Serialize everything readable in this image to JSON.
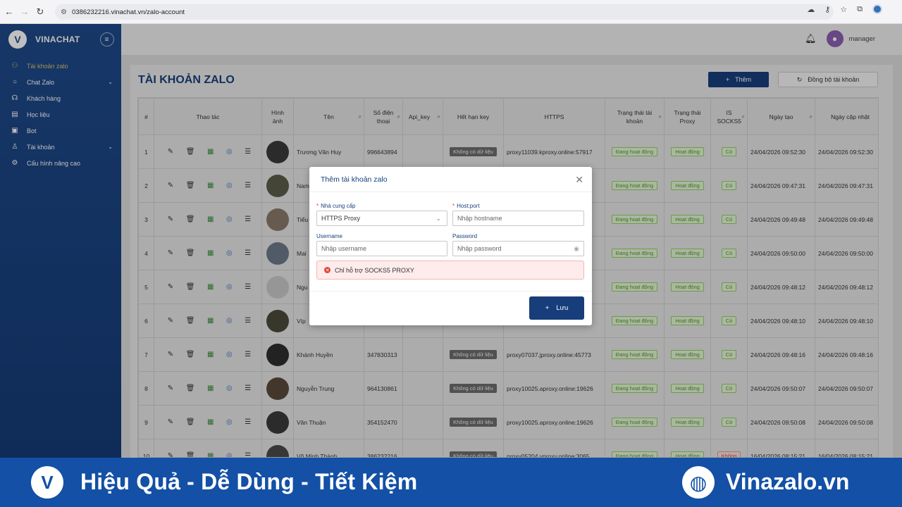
{
  "browser": {
    "url": "0386232216.vinachat.vn/zalo-account"
  },
  "sidebar": {
    "brand": "VINACHAT",
    "items": [
      {
        "label": "Tài khoản zalo",
        "icon": "users-icon",
        "active": true
      },
      {
        "label": "Chat Zalo",
        "icon": "chat-icon",
        "has_chevron": true
      },
      {
        "label": "Khách hàng",
        "icon": "headset-icon"
      },
      {
        "label": "Học liệu",
        "icon": "document-icon"
      },
      {
        "label": "Bot",
        "icon": "bot-icon"
      },
      {
        "label": "Tài khoản",
        "icon": "user-icon",
        "has_chevron": true
      },
      {
        "label": "Cấu hình nâng cao",
        "icon": "gear-icon"
      }
    ]
  },
  "header": {
    "user_name": "manager"
  },
  "page": {
    "title": "TÀI KHOẢN ZALO",
    "add_button": "Thêm",
    "sync_button": "Đồng bộ tài khoản"
  },
  "table": {
    "headers": {
      "num": "#",
      "actions": "Thao tác",
      "image": "Hình ảnh",
      "name": "Tên",
      "phone": "Số điện thoại",
      "api_key": "Api_key",
      "expire": "Hết hạn key",
      "https": "HTTPS",
      "account_status": "Trạng thái tài khoản",
      "proxy_status": "Trạng thái Proxy",
      "socks5": "IS SOCKS5",
      "created": "Ngày tạo",
      "updated": "Ngày cập nhật"
    },
    "rows": [
      {
        "num": "1",
        "name": "Trương Văn Huy",
        "phone": "996643894",
        "expire": "Không có dữ liệu",
        "https": "proxy11039.kproxy.online:57917",
        "account_status": "Đang hoạt động",
        "proxy_status": "Hoạt động",
        "socks5": "Có",
        "created": "24/04/2026 09:52:30",
        "updated": "24/04/2026 09:52:30",
        "avatar_color": "#3a3a3a"
      },
      {
        "num": "2",
        "name": "Nam",
        "phone": "",
        "expire": "",
        "https": "17",
        "account_status": "Đang hoạt động",
        "proxy_status": "Hoạt động",
        "socks5": "Có",
        "created": "24/04/2026 09:47:31",
        "updated": "24/04/2026 09:47:31",
        "avatar_color": "#5b5b4a"
      },
      {
        "num": "3",
        "name": "Tiểu",
        "phone": "",
        "expire": "",
        "https": "26",
        "account_status": "Đang hoạt động",
        "proxy_status": "Hoạt động",
        "socks5": "Có",
        "created": "24/04/2026 09:49:48",
        "updated": "24/04/2026 09:49:48",
        "avatar_color": "#8a7a6a"
      },
      {
        "num": "4",
        "name": "Mai",
        "phone": "",
        "expire": "",
        "https": "26",
        "account_status": "Đang hoạt động",
        "proxy_status": "Hoạt động",
        "socks5": "Có",
        "created": "24/04/2026 09:50:00",
        "updated": "24/04/2026 09:50:00",
        "avatar_color": "#6b7a8a"
      },
      {
        "num": "5",
        "name": "Ngu",
        "phone": "",
        "expire": "",
        "https": "73",
        "account_status": "Đang hoạt động",
        "proxy_status": "Hoạt động",
        "socks5": "Có",
        "created": "24/04/2026 09:48:12",
        "updated": "24/04/2026 09:48:12",
        "avatar_color": "#c9c9c9"
      },
      {
        "num": "6",
        "name": "Víp",
        "phone": "",
        "expire": "",
        "https": "73",
        "account_status": "Đang hoạt động",
        "proxy_status": "Hoạt động",
        "socks5": "Có",
        "created": "24/04/2026 09:48:10",
        "updated": "24/04/2026 09:48:10",
        "avatar_color": "#4a4a3a"
      },
      {
        "num": "7",
        "name": "Khánh Huyền",
        "phone": "347830313",
        "expire": "Không có dữ liệu",
        "https": "proxy07037.jproxy.online:45773",
        "account_status": "Đang hoạt động",
        "proxy_status": "Hoạt động",
        "socks5": "Có",
        "created": "24/04/2026 09:48:16",
        "updated": "24/04/2026 09:48:16",
        "avatar_color": "#2e2e2e"
      },
      {
        "num": "8",
        "name": "Nguyễn Trung",
        "phone": "964130861",
        "expire": "Không có dữ liệu",
        "https": "proxy10025.aproxy.online:19626",
        "account_status": "Đang hoạt động",
        "proxy_status": "Hoạt động",
        "socks5": "Có",
        "created": "24/04/2026 09:50:07",
        "updated": "24/04/2026 09:50:07",
        "avatar_color": "#5a4a3a"
      },
      {
        "num": "9",
        "name": "Văn Thuận",
        "phone": "354152470",
        "expire": "Không có dữ liệu",
        "https": "proxy10025.aproxy.online:19626",
        "account_status": "Đang hoạt động",
        "proxy_status": "Hoạt động",
        "socks5": "Có",
        "created": "24/04/2026 09:50:08",
        "updated": "24/04/2026 09:50:08",
        "avatar_color": "#3a3a3a"
      },
      {
        "num": "10",
        "name": "Võ Minh Thành",
        "phone": "386232216",
        "expire": "Không có dữ liệu",
        "https": "proxy05204.vproxy.online:3065",
        "account_status": "Đang hoạt động",
        "proxy_status": "Hoạt động",
        "socks5": "Không",
        "created": "16/04/2026 08:15:21",
        "updated": "16/04/2026 08:15:21",
        "avatar_color": "#4a4a4a"
      }
    ]
  },
  "modal": {
    "title": "Thêm tài khoản zalo",
    "provider_label": "Nhà cung cấp",
    "provider_value": "HTTPS Proxy",
    "host_label": "Host:port",
    "host_placeholder": "Nhập hostname",
    "username_label": "Username",
    "username_placeholder": "Nhập username",
    "password_label": "Password",
    "password_placeholder": "Nhập password",
    "alert_text": "Chỉ hỗ trợ SOCKS5 PROXY",
    "save_button": "Lưu"
  },
  "banner": {
    "slogan": "Hiệu Quả - Dễ Dùng - Tiết Kiệm",
    "site": "Vinazalo.vn"
  },
  "colors": {
    "primary": "#173e7b",
    "sidebar": "#1e4a8a",
    "banner": "#1350a6",
    "success": "#4a9a2a",
    "danger": "#e0453a"
  }
}
